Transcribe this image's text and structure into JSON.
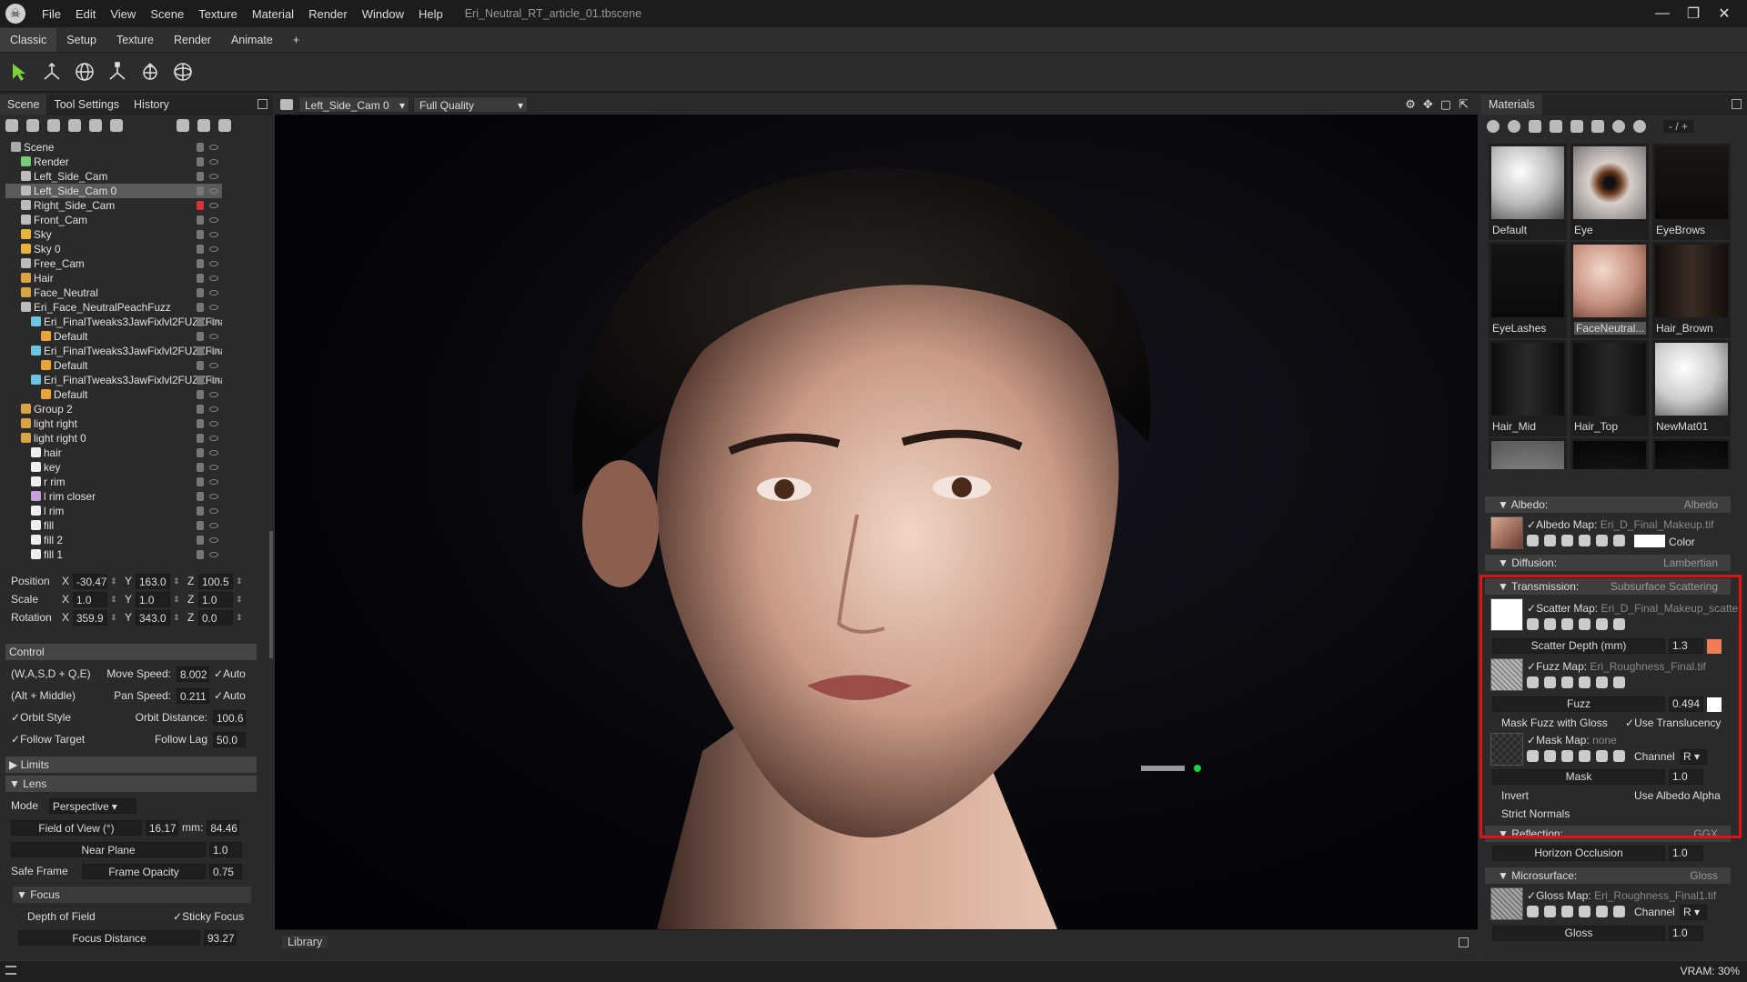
{
  "app": {
    "title": "Eri_Neutral_RT_article_01.tbscene"
  },
  "menu": [
    "File",
    "Edit",
    "View",
    "Scene",
    "Texture",
    "Material",
    "Render",
    "Window",
    "Help"
  ],
  "mode_tabs": [
    "Classic",
    "Setup",
    "Texture",
    "Render",
    "Animate",
    "+"
  ],
  "window_controls": {
    "minimize": "—",
    "restore": "❐",
    "close": "✕"
  },
  "left_tabs": [
    "Scene",
    "Tool Settings",
    "History"
  ],
  "tree": [
    {
      "label": "Scene",
      "indent": 0,
      "icon": "scene-icon",
      "color": "#aaa"
    },
    {
      "label": "Render",
      "indent": 1,
      "icon": "render-icon",
      "color": "#7c7"
    },
    {
      "label": "Left_Side_Cam",
      "indent": 1,
      "icon": "camera-icon",
      "color": "#bbb"
    },
    {
      "label": "Left_Side_Cam 0",
      "indent": 1,
      "icon": "camera-icon",
      "color": "#bbb",
      "selected": true
    },
    {
      "label": "Right_Side_Cam",
      "indent": 1,
      "icon": "camera-icon",
      "color": "#bbb",
      "red": true
    },
    {
      "label": "Front_Cam",
      "indent": 1,
      "icon": "camera-icon",
      "color": "#bbb"
    },
    {
      "label": "Sky",
      "indent": 1,
      "icon": "sky-icon",
      "color": "#e9b33c"
    },
    {
      "label": "Sky 0",
      "indent": 1,
      "icon": "sky-icon",
      "color": "#e9b33c"
    },
    {
      "label": "Free_Cam",
      "indent": 1,
      "icon": "camera-icon",
      "color": "#bbb"
    },
    {
      "label": "Hair",
      "indent": 1,
      "icon": "folder-icon",
      "color": "#d9a441"
    },
    {
      "label": "Face_Neutral",
      "indent": 1,
      "icon": "folder-icon",
      "color": "#d9a441"
    },
    {
      "label": "Eri_Face_NeutralPeachFuzz",
      "indent": 1,
      "icon": "mesh-icon",
      "color": "#bbb"
    },
    {
      "label": "Eri_FinalTweaks3JawFixlvl2FUZZFina",
      "indent": 2,
      "icon": "submesh-icon",
      "color": "#6bc5e0"
    },
    {
      "label": "Default",
      "indent": 3,
      "icon": "material-icon",
      "color": "#e8a33a"
    },
    {
      "label": "Eri_FinalTweaks3JawFixlvl2FUZZFina",
      "indent": 2,
      "icon": "submesh-icon",
      "color": "#6bc5e0"
    },
    {
      "label": "Default",
      "indent": 3,
      "icon": "material-icon",
      "color": "#e8a33a"
    },
    {
      "label": "Eri_FinalTweaks3JawFixlvl2FUZZFina",
      "indent": 2,
      "icon": "submesh-icon",
      "color": "#6bc5e0"
    },
    {
      "label": "Default",
      "indent": 3,
      "icon": "material-icon",
      "color": "#e8a33a"
    },
    {
      "label": "Group 2",
      "indent": 1,
      "icon": "folder-icon",
      "color": "#d9a441"
    },
    {
      "label": "light right",
      "indent": 1,
      "icon": "folder-icon",
      "color": "#d9a441"
    },
    {
      "label": "light right 0",
      "indent": 1,
      "icon": "folder-icon",
      "color": "#d9a441"
    },
    {
      "label": "hair",
      "indent": 2,
      "icon": "light-icon",
      "color": "#eee"
    },
    {
      "label": "key",
      "indent": 2,
      "icon": "light-icon",
      "color": "#eee"
    },
    {
      "label": "r rim",
      "indent": 2,
      "icon": "light-icon",
      "color": "#eee"
    },
    {
      "label": "l rim closer",
      "indent": 2,
      "icon": "light-icon",
      "color": "#c8a0e0"
    },
    {
      "label": "l rim",
      "indent": 2,
      "icon": "light-icon",
      "color": "#eee"
    },
    {
      "label": "fill",
      "indent": 2,
      "icon": "light-icon",
      "color": "#eee"
    },
    {
      "label": "fill 2",
      "indent": 2,
      "icon": "light-icon",
      "color": "#eee"
    },
    {
      "label": "fill 1",
      "indent": 2,
      "icon": "light-icon",
      "color": "#eee"
    }
  ],
  "transform": {
    "position": {
      "label": "Position",
      "x": "-30.47",
      "y": "163.0",
      "z": "100.5"
    },
    "scale": {
      "label": "Scale",
      "x": "1.0",
      "y": "1.0",
      "z": "1.0"
    },
    "rotation": {
      "label": "Rotation",
      "x": "359.9",
      "y": "343.0",
      "z": "0.0"
    },
    "axes": {
      "x": "X",
      "y": "Y",
      "z": "Z"
    }
  },
  "control": {
    "title": "Control",
    "wasd": "(W,A,S,D + Q,E)",
    "move_speed_label": "Move Speed:",
    "move_speed": "8.002",
    "auto1": "Auto",
    "altmid": "(Alt + Middle)",
    "pan_speed_label": "Pan Speed:",
    "pan_speed": "0.211",
    "auto2": "Auto",
    "orbit_style": "Orbit Style",
    "orbit_distance_label": "Orbit Distance:",
    "orbit_distance": "100.6",
    "follow_target": "Follow Target",
    "follow_lag_label": "Follow Lag",
    "follow_lag": "50.0"
  },
  "limits": {
    "title": "Limits"
  },
  "lens": {
    "title": "Lens",
    "mode_label": "Mode",
    "mode": "Perspective",
    "fov_label": "Field of View (°)",
    "fov": "16.17",
    "mm_label": "mm:",
    "mm": "84.46",
    "near_plane_label": "Near Plane",
    "near_plane": "1.0",
    "safe_frame": "Safe Frame",
    "frame_opacity_label": "Frame Opacity",
    "frame_opacity": "0.75"
  },
  "focus": {
    "title": "Focus",
    "dof": "Depth of Field",
    "sticky": "Sticky Focus",
    "focus_distance_label": "Focus Distance",
    "focus_distance": "93.27"
  },
  "viewport": {
    "camera": "Left_Side_Cam 0",
    "quality": "Full Quality",
    "library": "Library"
  },
  "materials": {
    "title": "Materials",
    "counter": "- / +",
    "swatches": [
      "Default",
      "Eye",
      "EyeBrows",
      "EyeLashes",
      "FaceNeutral...",
      "Hair_Brown",
      "Hair_Mid",
      "Hair_Top",
      "NewMat01"
    ],
    "albedo": {
      "header": "Albedo:",
      "mode": "Albedo",
      "map_label": "Albedo Map:",
      "map": "Eri_D_Final_Makeup.tif",
      "color_label": "Color"
    },
    "diffusion": {
      "header": "Diffusion:",
      "mode": "Lambertian"
    },
    "transmission": {
      "header": "Transmission:",
      "mode": "Subsurface Scattering",
      "scatter_label": "Scatter Map:",
      "scatter_map": "Eri_D_Final_Makeup_scatte",
      "scatter_depth_label": "Scatter Depth (mm)",
      "scatter_depth": "1.3",
      "scatter_color": "#f07d58",
      "fuzz_map_label": "Fuzz Map:",
      "fuzz_map": "Eri_Roughness_Final.tif",
      "fuzz_label": "Fuzz",
      "fuzz": "0.494",
      "mask_fuzz": "Mask Fuzz with Gloss",
      "use_translucency": "Use Translucency",
      "mask_map_label": "Mask Map:",
      "mask_map": "none",
      "channel_label": "Channel",
      "channel": "R",
      "mask_label": "Mask",
      "mask": "1.0",
      "invert": "Invert",
      "use_albedo_alpha": "Use Albedo Alpha",
      "strict_normals": "Strict Normals"
    },
    "reflection": {
      "header": "Reflection:",
      "mode": "GGX",
      "horizon_label": "Horizon Occlusion",
      "horizon": "1.0"
    },
    "microsurface": {
      "header": "Microsurface:",
      "mode": "Gloss",
      "gloss_map_label": "Gloss Map:",
      "gloss_map": "Eri_Roughness_Final1.tif",
      "channel_label": "Channel",
      "channel": "R",
      "gloss_label": "Gloss",
      "gloss": "1.0"
    }
  },
  "status": {
    "vram": "VRAM: 30%"
  },
  "colors": {
    "highlight": "#e11111",
    "accent_green": "#22cc44"
  }
}
